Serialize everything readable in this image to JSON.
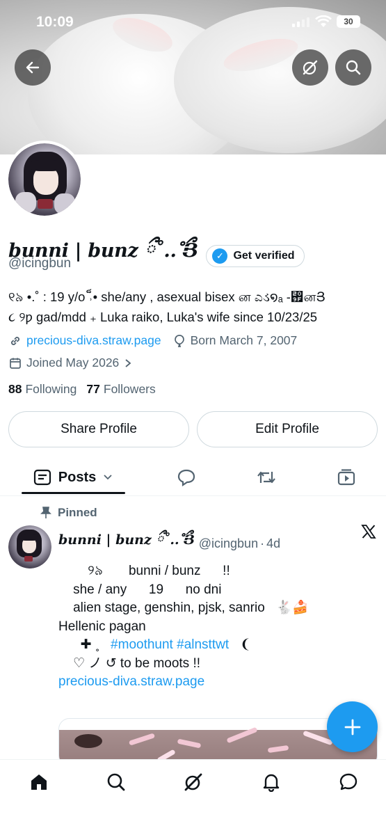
{
  "status_bar": {
    "time": "10:09",
    "battery": "30"
  },
  "profile": {
    "display_name": "bunni | bunz ྀ˚․․˚ྀՅ",
    "get_verified_label": "Get verified",
    "handle": "@icingbun",
    "bio_line1": "୧৯ •.˚ : 19 y/o ˒็• she/any , asexual bisex ன ಎડ໑ₐ -₟னՅ",
    "bio_line2": "૮ ୨ƿ gad/mdd ₊ Luka raiko, Luka's wife since 10/23/25",
    "website": "precious-diva.straw.page",
    "born": "Born March 7, 2007",
    "joined": "Joined May 2026",
    "following_count": "88",
    "following_label": "Following",
    "followers_count": "77",
    "followers_label": "Followers"
  },
  "actions": {
    "share": "Share Profile",
    "edit": "Edit Profile"
  },
  "tabs": {
    "posts": "Posts"
  },
  "pinned_post": {
    "pinned_label": "Pinned",
    "author_name": "bunni | bunz ྀ˚․․˚ྀՅ",
    "author_handle": "@icingbun",
    "age": "4d",
    "line1": "        ୨৯       bunni / bunz      !!",
    "line2": "    she / any      19      no dni",
    "line3": "    alien stage, genshin, pjsk, sanrio   🐇🍰",
    "line4": "Hellenic pagan",
    "line5_prefix": "      ✚ ˳   ",
    "hashtag1": "#moothunt",
    "hashtag2": "#alnsttwt",
    "line5_suffix": "   ❨",
    "line6": "    ♡ ノ ↺ to be moots !!",
    "link": "precious-diva.straw.page"
  },
  "icons": [
    "back-arrow-icon",
    "grok-icon",
    "search-icon",
    "link-icon",
    "birthday-icon",
    "calendar-icon",
    "posts-icon",
    "replies-icon",
    "reposts-icon",
    "media-icon",
    "pin-icon",
    "x-logo-icon",
    "compose-plus-icon",
    "home-icon",
    "explore-icon",
    "grok-nav-icon",
    "notifications-icon",
    "messages-icon"
  ],
  "colors": {
    "accent": "#1d9bf0",
    "text": "#0f1419",
    "secondary": "#536471"
  }
}
